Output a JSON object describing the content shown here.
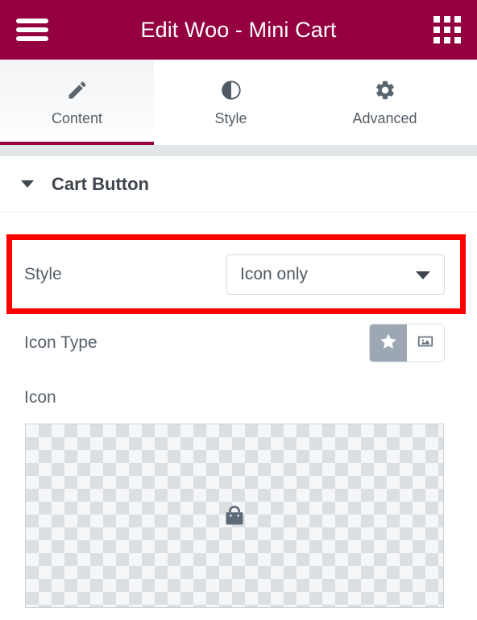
{
  "header": {
    "title": "Edit Woo - Mini Cart",
    "menu_icon": "hamburger-menu-icon",
    "apps_icon": "grid-apps-icon",
    "background_color": "#94003f"
  },
  "tabs": [
    {
      "label": "Content",
      "icon": "pencil-icon",
      "active": true
    },
    {
      "label": "Style",
      "icon": "contrast-half-circle-icon",
      "active": false
    },
    {
      "label": "Advanced",
      "icon": "gear-icon",
      "active": false
    }
  ],
  "section": {
    "title": "Cart Button",
    "collapse_icon": "caret-down-icon",
    "expanded": true
  },
  "controls": {
    "style": {
      "label": "Style",
      "value": "Icon only",
      "caret_icon": "chevron-down-icon",
      "options": [
        "Icon only"
      ]
    },
    "icon_type": {
      "label": "Icon Type",
      "buttons": [
        {
          "icon": "star-icon",
          "active": true
        },
        {
          "icon": "image-icon",
          "active": false
        }
      ]
    },
    "icon": {
      "label": "Icon",
      "preview_icon": "shopping-bag-icon"
    }
  },
  "highlight": {
    "color": "#fe0000",
    "target": "style-row"
  }
}
